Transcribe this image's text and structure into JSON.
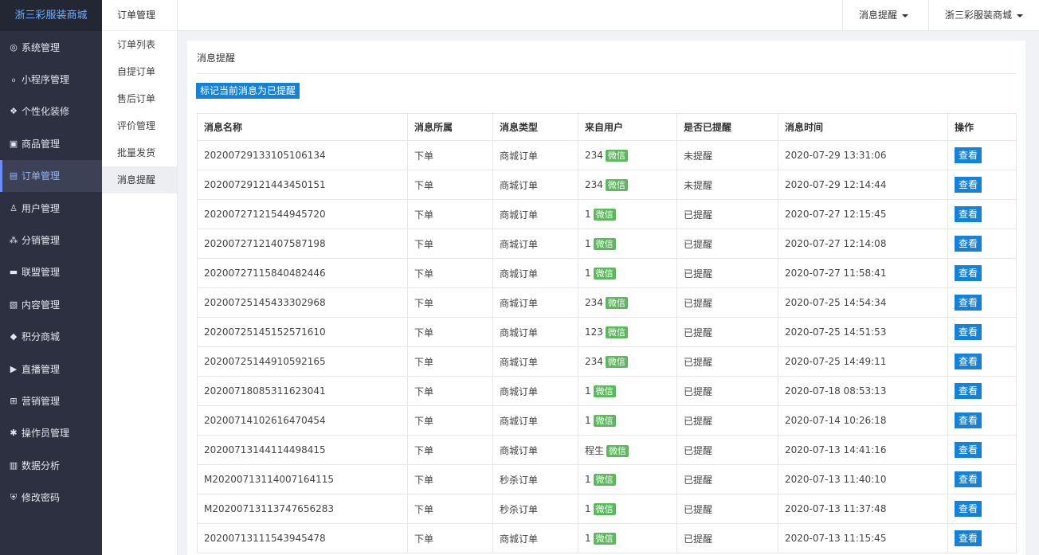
{
  "brand": "浙三彩服装商城",
  "sidebar": {
    "items": [
      {
        "label": "系统管理",
        "icon": "gear-circle-icon",
        "glyph": "◎",
        "active": false
      },
      {
        "label": "小程序管理",
        "icon": "mini-program-icon",
        "glyph": "ℴ",
        "active": false
      },
      {
        "label": "个性化装修",
        "icon": "palette-icon",
        "glyph": "❖",
        "active": false
      },
      {
        "label": "商品管理",
        "icon": "shopping-bag-icon",
        "glyph": "▣",
        "active": false
      },
      {
        "label": "订单管理",
        "icon": "order-list-icon",
        "glyph": "▤",
        "active": true
      },
      {
        "label": "用户管理",
        "icon": "user-icon",
        "glyph": "♙",
        "active": false
      },
      {
        "label": "分销管理",
        "icon": "sitemap-icon",
        "glyph": "⁂",
        "active": false
      },
      {
        "label": "联盟管理",
        "icon": "store-icon",
        "glyph": "▬",
        "active": false
      },
      {
        "label": "内容管理",
        "icon": "content-card-icon",
        "glyph": "▧",
        "active": false
      },
      {
        "label": "积分商城",
        "icon": "cube-icon",
        "glyph": "◆",
        "active": false
      },
      {
        "label": "直播管理",
        "icon": "play-icon",
        "glyph": "▶",
        "active": false
      },
      {
        "label": "营销管理",
        "icon": "marketing-icon",
        "glyph": "⊞",
        "active": false
      },
      {
        "label": "操作员管理",
        "icon": "cog-icon",
        "glyph": "✱",
        "active": false
      },
      {
        "label": "数据分析",
        "icon": "bar-chart-icon",
        "glyph": "▥",
        "active": false
      },
      {
        "label": "修改密码",
        "icon": "shield-icon",
        "glyph": "⛨",
        "active": false
      }
    ]
  },
  "subnav": {
    "title": "订单管理",
    "items": [
      {
        "label": "订单列表",
        "active": false
      },
      {
        "label": "自提订单",
        "active": false
      },
      {
        "label": "售后订单",
        "active": false
      },
      {
        "label": "评价管理",
        "active": false
      },
      {
        "label": "批量发货",
        "active": false
      },
      {
        "label": "消息提醒",
        "active": true
      }
    ]
  },
  "header": {
    "notify_label": "消息提醒",
    "store_label": "浙三彩服装商城"
  },
  "panel": {
    "title": "消息提醒",
    "mark_button": "标记当前消息为已提醒"
  },
  "table": {
    "headers": [
      "消息名称",
      "消息所属",
      "消息类型",
      "来自用户",
      "是否已提醒",
      "消息时间",
      "操作"
    ],
    "badge": "微信",
    "action_label": "查看",
    "rows": [
      {
        "name": "20200729133105106134",
        "belong": "下单",
        "type": "商城订单",
        "user": "234",
        "reminded": "未提醒",
        "time": "2020-07-29 13:31:06"
      },
      {
        "name": "20200729121443450151",
        "belong": "下单",
        "type": "商城订单",
        "user": "234",
        "reminded": "未提醒",
        "time": "2020-07-29 12:14:44"
      },
      {
        "name": "20200727121544945720",
        "belong": "下单",
        "type": "商城订单",
        "user": "1",
        "reminded": "已提醒",
        "time": "2020-07-27 12:15:45"
      },
      {
        "name": "20200727121407587198",
        "belong": "下单",
        "type": "商城订单",
        "user": "1",
        "reminded": "已提醒",
        "time": "2020-07-27 12:14:08"
      },
      {
        "name": "20200727115840482446",
        "belong": "下单",
        "type": "商城订单",
        "user": "1",
        "reminded": "已提醒",
        "time": "2020-07-27 11:58:41"
      },
      {
        "name": "20200725145433302968",
        "belong": "下单",
        "type": "商城订单",
        "user": "234",
        "reminded": "已提醒",
        "time": "2020-07-25 14:54:34"
      },
      {
        "name": "20200725145152571610",
        "belong": "下单",
        "type": "商城订单",
        "user": "123",
        "reminded": "已提醒",
        "time": "2020-07-25 14:51:53"
      },
      {
        "name": "20200725144910592165",
        "belong": "下单",
        "type": "商城订单",
        "user": "234",
        "reminded": "已提醒",
        "time": "2020-07-25 14:49:11"
      },
      {
        "name": "20200718085311623041",
        "belong": "下单",
        "type": "商城订单",
        "user": "1",
        "reminded": "已提醒",
        "time": "2020-07-18 08:53:13"
      },
      {
        "name": "20200714102616470454",
        "belong": "下单",
        "type": "商城订单",
        "user": "1",
        "reminded": "已提醒",
        "time": "2020-07-14 10:26:18"
      },
      {
        "name": "20200713144114498415",
        "belong": "下单",
        "type": "商城订单",
        "user": "程生",
        "reminded": "已提醒",
        "time": "2020-07-13 14:41:16"
      },
      {
        "name": "M20200713114007164115",
        "belong": "下单",
        "type": "秒杀订单",
        "user": "1",
        "reminded": "已提醒",
        "time": "2020-07-13 11:40:10"
      },
      {
        "name": "M20200713113747656283",
        "belong": "下单",
        "type": "秒杀订单",
        "user": "1",
        "reminded": "已提醒",
        "time": "2020-07-13 11:37:48"
      },
      {
        "name": "20200713111543945478",
        "belong": "下单",
        "type": "商城订单",
        "user": "1",
        "reminded": "已提醒",
        "time": "2020-07-13 11:15:45"
      }
    ]
  }
}
